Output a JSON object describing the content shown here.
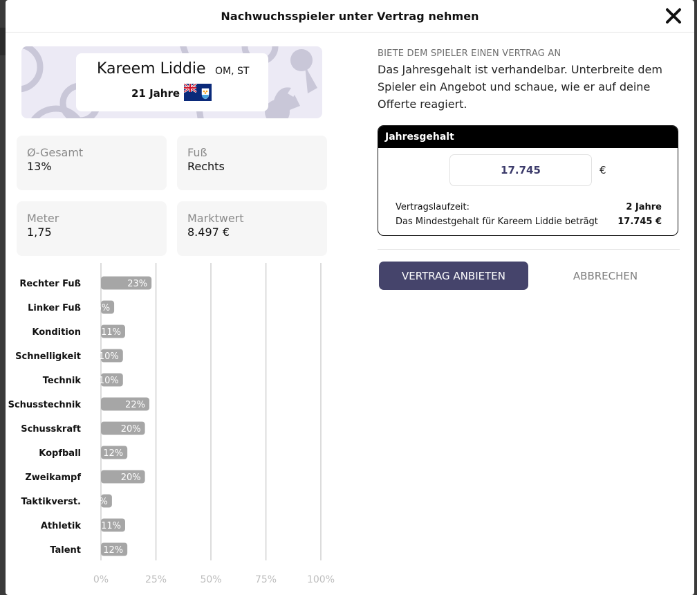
{
  "modal": {
    "title": "Nachwuchsspieler unter Vertrag nehmen"
  },
  "player": {
    "name": "Kareem Liddie",
    "positions": "OM, ST",
    "age": "21 Jahre",
    "flag_icon": "anguilla-flag-icon"
  },
  "stats": [
    {
      "label": "Ø-Gesamt",
      "value": "13%"
    },
    {
      "label": "Fuß",
      "value": "Rechts"
    },
    {
      "label": "Meter",
      "value": "1,75"
    },
    {
      "label": "Marktwert",
      "value": "8.497 €"
    }
  ],
  "chart_data": {
    "type": "bar",
    "orientation": "horizontal",
    "categories": [
      "Rechter Fuß",
      "Linker Fuß",
      "Kondition",
      "Schnelligkeit",
      "Technik",
      "Schusstechnik",
      "Schusskraft",
      "Kopfball",
      "Zweikampf",
      "Taktikverst.",
      "Athletik",
      "Talent"
    ],
    "values": [
      23,
      6,
      11,
      10,
      10,
      22,
      20,
      12,
      20,
      5,
      11,
      12
    ],
    "value_labels": [
      "23%",
      "6%",
      "11%",
      "10%",
      "10%",
      "22%",
      "20%",
      "12%",
      "20%",
      "5%",
      "11%",
      "12%"
    ],
    "xlim": [
      0,
      100
    ],
    "xticks": [
      0,
      25,
      50,
      75,
      100
    ],
    "xtick_labels": [
      "0%",
      "25%",
      "50%",
      "75%",
      "100%"
    ],
    "grid": true,
    "bar_color": "#a6a6a6"
  },
  "offer": {
    "heading": "BIETE DEM SPIELER EINEN VERTRAG AN",
    "text": "Das Jahresgehalt ist verhandelbar. Unterbreite dem Spieler ein Angebot und schaue, wie er auf deine Offerte reagiert.",
    "salary_header": "Jahresgehalt",
    "salary_value": "17.745",
    "currency": "€",
    "duration_label": "Vertragslaufzeit:",
    "duration_value": "2 Jahre",
    "min_salary_label": "Das Mindestgehalt für Kareem Liddie beträgt",
    "min_salary_value": "17.745 €"
  },
  "buttons": {
    "submit": "VERTRAG ANBIETEN",
    "cancel": "ABBRECHEN"
  },
  "colors": {
    "primary_button": "#45446b",
    "salary_text": "#3c3b6b",
    "card_bg": "#eceaf5"
  }
}
